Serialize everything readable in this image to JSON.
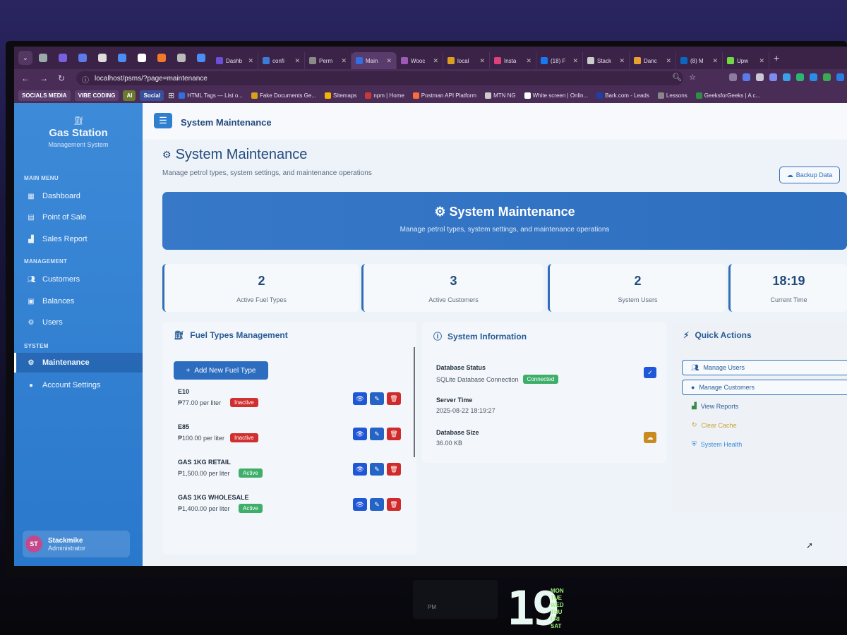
{
  "browser": {
    "tabs": [
      {
        "label": "Dashb",
        "color": "#6b4fd8"
      },
      {
        "label": "confi",
        "color": "#3c7bd8"
      },
      {
        "label": "Perm",
        "color": "#8a8a8a"
      },
      {
        "label": "Main",
        "color": "#2f6fe0",
        "active": true
      },
      {
        "label": "Wooc",
        "color": "#9b5bb5"
      },
      {
        "label": "local",
        "color": "#d9a020"
      },
      {
        "label": "Insta",
        "color": "#e0407a"
      },
      {
        "label": "(18) F",
        "color": "#1877f2"
      },
      {
        "label": "Stack",
        "color": "#cccccc"
      },
      {
        "label": "Danc",
        "color": "#e8a030"
      },
      {
        "label": "(8) M",
        "color": "#0a66c2"
      },
      {
        "label": "Upw",
        "color": "#6fda44"
      }
    ],
    "url": "localhost/psms/?page=maintenance",
    "bookmarks": {
      "chips": [
        "SOCIALS MEDIA",
        "VIBE CODING",
        "AI",
        "Social"
      ],
      "items": [
        {
          "label": "HTML Tags — List o...",
          "color": "#2f6fe0"
        },
        {
          "label": "Fake Documents Ge...",
          "color": "#d9a020"
        },
        {
          "label": "Sitemaps",
          "color": "#f4b400"
        },
        {
          "label": "npm | Home",
          "color": "#cb3837"
        },
        {
          "label": "Postman API Platform",
          "color": "#ff6c37"
        },
        {
          "label": "MTN NG",
          "color": "#cccccc"
        },
        {
          "label": "White screen | Onlin...",
          "color": "#ffffff"
        },
        {
          "label": "Bark.com - Leads",
          "color": "#1d3fa8"
        },
        {
          "label": "Lessons",
          "color": "#888888"
        },
        {
          "label": "GeeksforGeeks | A c...",
          "color": "#2f8d46"
        }
      ]
    }
  },
  "sidebar": {
    "brand": "Gas Station",
    "brand_sub": "Management System",
    "sections": {
      "main_menu": "MAIN MENU",
      "management": "MANAGEMENT",
      "system": "SYSTEM"
    },
    "items": {
      "dashboard": "Dashboard",
      "pos": "Point of Sale",
      "sales": "Sales Report",
      "customers": "Customers",
      "balances": "Balances",
      "users": "Users",
      "maintenance": "Maintenance",
      "account": "Account Settings"
    },
    "user": {
      "initials": "ST",
      "name": "Stackmike",
      "role": "Administrator"
    }
  },
  "topbar": {
    "title": "System Maintenance"
  },
  "page": {
    "title": "System Maintenance",
    "subtitle": "Manage petrol types, system settings, and maintenance operations",
    "backup_label": "Backup Data"
  },
  "hero": {
    "title": "System Maintenance",
    "subtitle": "Manage petrol types, system settings, and maintenance operations"
  },
  "stats": {
    "fuel": {
      "value": "2",
      "label": "Active Fuel Types"
    },
    "customers": {
      "value": "3",
      "label": "Active Customers"
    },
    "users": {
      "value": "2",
      "label": "System Users"
    },
    "time": {
      "value": "18:19",
      "label": "Current Time"
    }
  },
  "fuel_mgmt": {
    "title": "Fuel Types Management",
    "add_label": "Add New Fuel Type",
    "items": [
      {
        "name": "E10",
        "price": "₱77.00 per liter",
        "status": "Inactive"
      },
      {
        "name": "E85",
        "price": "₱100.00 per liter",
        "status": "Inactive"
      },
      {
        "name": "GAS 1KG RETAIL",
        "price": "₱1,500.00 per liter",
        "status": "Active"
      },
      {
        "name": "GAS 1KG WHOLESALE",
        "price": "₱1,400.00 per liter",
        "status": "Active"
      }
    ]
  },
  "system_info": {
    "title": "System Information",
    "db_status_label": "Database Status",
    "db_status_value": "SQLite Database Connection",
    "db_status_badge": "Connected",
    "server_time_label": "Server Time",
    "server_time_value": "2025-08-22 18:19:27",
    "db_size_label": "Database Size",
    "db_size_value": "36.00 KB"
  },
  "quick_actions": {
    "title": "Quick Actions",
    "manage_users": "Manage Users",
    "manage_customers": "Manage Customers",
    "view_reports": "View Reports",
    "clear_cache": "Clear Cache",
    "system_health": "System Health"
  },
  "colors": {
    "primary": "#2f6fb8",
    "active": "#3fae6a",
    "inactive": "#d0302f",
    "warning": "#d9a020"
  },
  "desk_clock": {
    "time": "19",
    "meridiem": "PM",
    "days": [
      "MON",
      "TUE",
      "WED",
      "THU",
      "FRI",
      "SAT"
    ]
  }
}
